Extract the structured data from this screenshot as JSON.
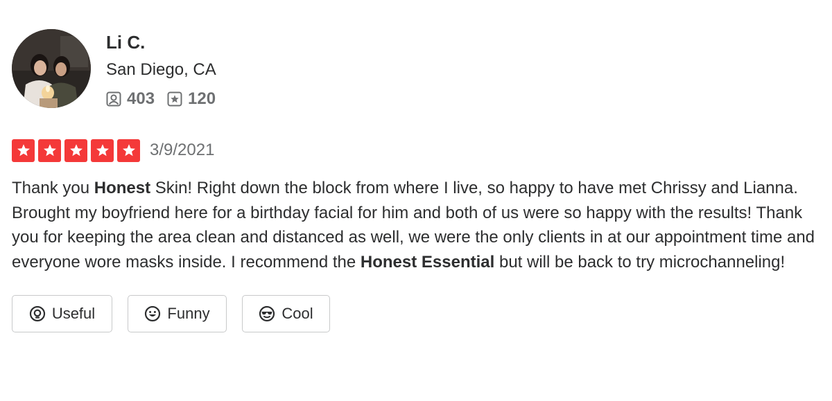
{
  "user": {
    "name": "Li C.",
    "location": "San Diego, CA",
    "friends_count": "403",
    "reviews_count": "120"
  },
  "review": {
    "rating": 5,
    "max_rating": 5,
    "date": "3/9/2021",
    "text_parts": {
      "p1": "Thank you ",
      "b1": "Honest",
      "p2": " Skin! Right down the block from where I live, so happy to have met Chrissy and Lianna. Brought my boyfriend here for a birthday facial for him and both of us were so happy with the results! Thank you for keeping the area clean and distanced as well, we were the only clients in at our appointment time and everyone wore masks inside. I recommend the ",
      "b2": "Honest Essential",
      "p3": " but will be back to try microchanneling!"
    }
  },
  "reactions": {
    "useful_label": "Useful",
    "funny_label": "Funny",
    "cool_label": "Cool"
  },
  "colors": {
    "star_red": "#f43939",
    "text_dark": "#2d2e2f",
    "text_gray": "#6e7072",
    "border_gray": "#c8c9ca"
  },
  "icons": {
    "friends": "friends-icon",
    "reviews": "review-star-icon",
    "useful": "lightbulb-icon",
    "funny": "smile-icon",
    "cool": "sunglasses-icon"
  }
}
